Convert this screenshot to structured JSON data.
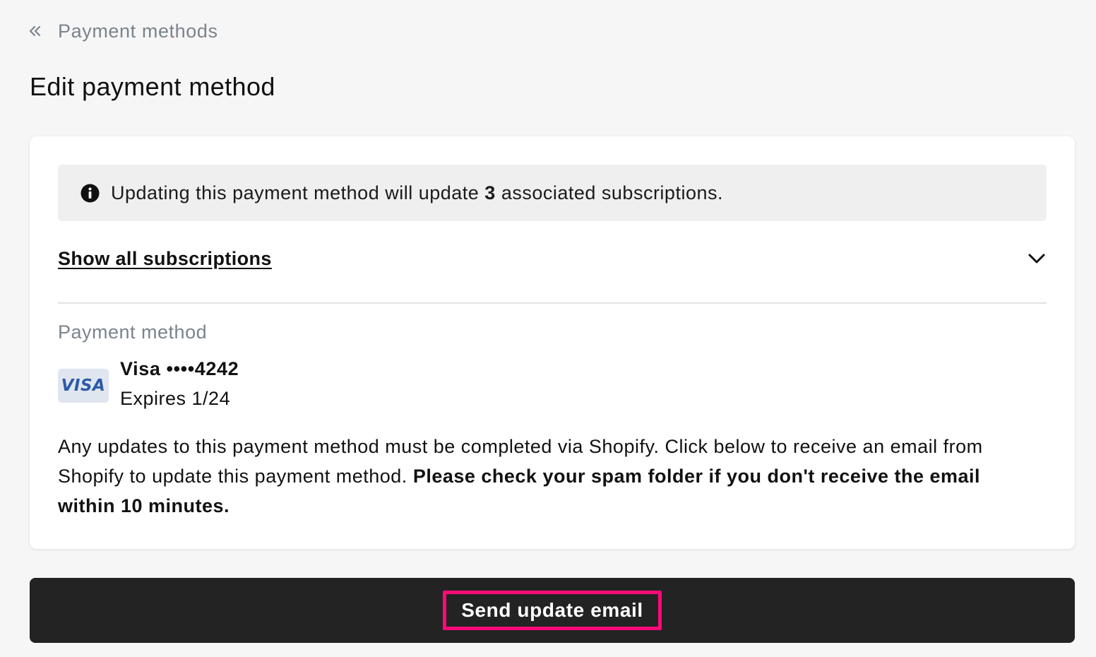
{
  "nav": {
    "back_label": "Payment methods",
    "back_icon": "double-chevron-left-icon"
  },
  "page": {
    "title": "Edit payment method"
  },
  "notice": {
    "icon": "info-icon",
    "text_before": "Updating this payment method will update ",
    "count": "3",
    "text_after": " associated subscriptions."
  },
  "subscriptions_toggle": {
    "label": "Show all subscriptions",
    "icon": "chevron-down-icon"
  },
  "payment_method": {
    "heading": "Payment method",
    "brand_logo": "VISA",
    "card_label": "Visa ••••4242",
    "expiry": "Expires 1/24"
  },
  "description": {
    "text": "Any updates to this payment method must be completed via Shopify. Click below to receive an email from Shopify to update this payment method. ",
    "bold_text": "Please check your spam folder if you don't receive the email within 10 minutes."
  },
  "actions": {
    "send_label": "Send update email"
  },
  "colors": {
    "page_background": "#f6f6f6",
    "button_background": "#232323",
    "highlight": "#ff0a78",
    "muted_text": "#7b838c",
    "visa_blue": "#2d59a8"
  }
}
